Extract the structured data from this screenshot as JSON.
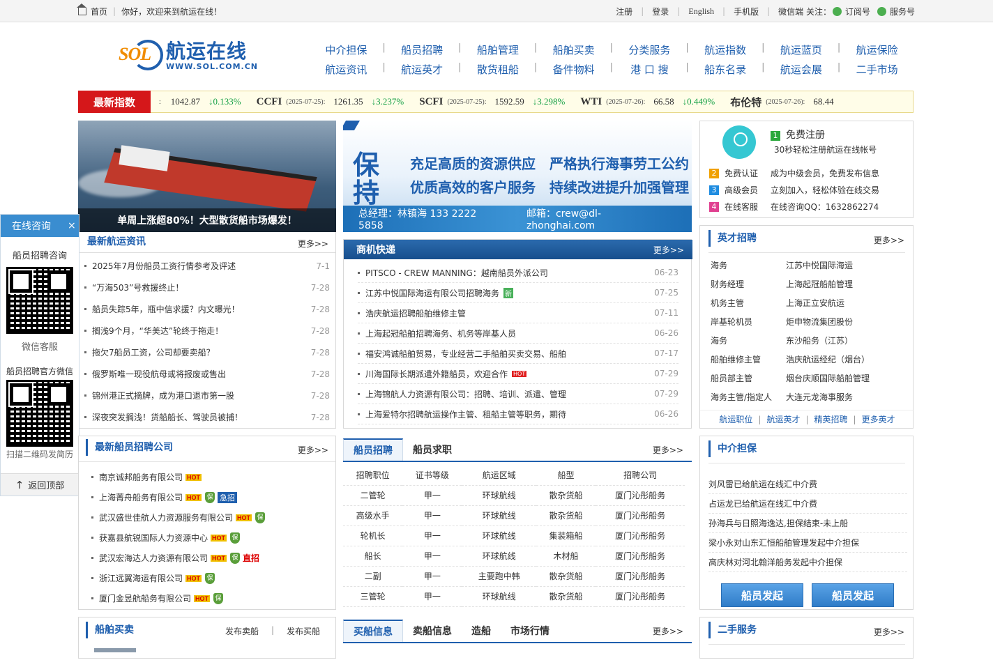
{
  "topbar": {
    "home": "首页",
    "welcome": "你好，欢迎来到航运在线！",
    "register": "注册",
    "login": "登录",
    "english": "English",
    "mobile": "手机版",
    "wechat_follow": "微信端 关注：",
    "subscription": "订阅号",
    "service": "服务号"
  },
  "logo": {
    "mark": "SOL",
    "cn": "航运在线",
    "url": "WWW.SOL.COM.CN"
  },
  "nav": {
    "row1": [
      "中介担保",
      "船员招聘",
      "船舶管理",
      "船舶买卖",
      "分类服务",
      "航运指数",
      "航运蓝页",
      "航运保险"
    ],
    "row2": [
      "航运资讯",
      "航运英才",
      "散货租船",
      "备件物料",
      "港 口 搜",
      "船东名录",
      "航运会展",
      "二手市场"
    ]
  },
  "ticker": {
    "label": "最新指数",
    "lead_colon": ":",
    "lead_value": "1042.87",
    "lead_change": "↓0.133%",
    "items": [
      {
        "name": "CCFI",
        "date": "(2025-07-25):",
        "value": "1261.35",
        "change": "↓3.237%"
      },
      {
        "name": "SCFI",
        "date": "(2025-07-25):",
        "value": "1592.59",
        "change": "↓3.298%"
      },
      {
        "name": "WTI",
        "date": "(2025-07-26):",
        "value": "66.58",
        "change": "↓0.449%"
      },
      {
        "name": "布伦特",
        "date": "(2025-07-26):",
        "value": "68.44",
        "change": ""
      }
    ]
  },
  "photo": {
    "caption": "单周上涨超80%！大型散货船市场爆发！"
  },
  "banner": {
    "big": "保持",
    "line1": "充足高质的资源供应　严格执行海事劳工公约",
    "line2": "优质高效的客户服务　持续改进提升加强管理",
    "manager": "总经理：林镇海 133 2222 5858",
    "email": "邮箱：crew@dl-zhonghai.com"
  },
  "register": {
    "step1": "免费注册",
    "step1_sub": "30秒轻松注册航运在线帐号",
    "rows": [
      {
        "num": "2",
        "key": "免费认证",
        "val": "成为中级会员，免费发布信息"
      },
      {
        "num": "3",
        "key": "高级会员",
        "val": "立刻加入，轻松体验在线交易"
      },
      {
        "num": "4",
        "key": "在线客服",
        "val": "在线咨询QQ：1632862274"
      }
    ]
  },
  "news": {
    "title": "最新航运资讯",
    "more": "更多>>",
    "items": [
      {
        "t": "2025年7月份船员工资行情参考及评述",
        "d": "7-1"
      },
      {
        "t": "“万海503”号救援终止！",
        "d": "7-28"
      },
      {
        "t": "船员失踪5年，瓶中信求援？内文曝光！",
        "d": "7-28"
      },
      {
        "t": "搁浅9个月，“华美达”轮终于拖走！",
        "d": "7-28"
      },
      {
        "t": "拖欠7船员工资，公司却要卖船？",
        "d": "7-28"
      },
      {
        "t": "俄罗斯唯一现役航母或将报废或售出",
        "d": "7-28"
      },
      {
        "t": "锦州港正式摘牌，成为港口退市第一股",
        "d": "7-28"
      },
      {
        "t": "深夜突发搁浅！货船船长、驾驶员被捕！",
        "d": "7-28"
      }
    ]
  },
  "biz": {
    "title": "商机快递",
    "more": "更多>>",
    "items": [
      {
        "t": "PITSCO - CREW MANNING：越南船员外派公司",
        "d": "06-23",
        "tag": ""
      },
      {
        "t": "江苏中悦国际海运有限公司招聘海务",
        "d": "07-25",
        "tag": "new"
      },
      {
        "t": "浩庆航运招聘船舶维修主管",
        "d": "07-11",
        "tag": ""
      },
      {
        "t": "上海起冠船舶招聘海务、机务等岸基人员",
        "d": "06-26",
        "tag": ""
      },
      {
        "t": "福安鸿诚船舶贸易，专业经营二手船舶买卖交易、船舶",
        "d": "07-17",
        "tag": ""
      },
      {
        "t": "川海国际长期派遣外籍船员，欢迎合作",
        "d": "07-29",
        "tag": "hot"
      },
      {
        "t": "上海锦航人力资源有限公司：招聘、培训、派遣、管理",
        "d": "07-29",
        "tag": ""
      },
      {
        "t": "上海爱特尔招聘航运操作主管、租船主管等职务，期待",
        "d": "06-26",
        "tag": ""
      }
    ],
    "new_label": "新",
    "hot_label": "HOT"
  },
  "talent": {
    "title": "英才招聘",
    "more": "更多>>",
    "rows": [
      [
        "海务",
        "江苏中悦国际海运"
      ],
      [
        "财务经理",
        "上海起冠船舶管理"
      ],
      [
        "机务主管",
        "上海正立安航运"
      ],
      [
        "岸基轮机员",
        "炬申物流集团股份"
      ],
      [
        "海务",
        "东沙船务（江苏）"
      ],
      [
        "船舶维修主管",
        "浩庆航运经纪（烟台）"
      ],
      [
        "船员部主管",
        "烟台庆顺国际船舶管理"
      ],
      [
        "海务主管/指定人",
        "大连元龙海事服务"
      ]
    ],
    "foot": [
      "航运职位",
      "航运英才",
      "精英招聘",
      "更多英才"
    ]
  },
  "side": {
    "head": "在线咨询",
    "close": "×",
    "t1": "船员招聘咨询",
    "t2": "微信客服",
    "t3": "船员招聘官方微信",
    "t4": "扫描二维码发简历",
    "top": "返回顶部"
  },
  "companies": {
    "title": "最新船员招聘公司",
    "more": "更多>>",
    "items": [
      {
        "t": "南京诚邦船务有限公司",
        "tags": [
          "hot"
        ]
      },
      {
        "t": "上海菁舟船务有限公司",
        "tags": [
          "hot",
          "bao",
          "ji"
        ]
      },
      {
        "t": "武汉盛世佳航人力资源服务有限公司",
        "tags": [
          "hot",
          "bao"
        ]
      },
      {
        "t": "获嘉县航锐国际人力资源中心",
        "tags": [
          "hot",
          "bao"
        ]
      },
      {
        "t": "武汉宏海达人力资源有限公司",
        "tags": [
          "hot",
          "bao",
          "zhi"
        ]
      },
      {
        "t": "浙江远翼海运有限公司",
        "tags": [
          "hot",
          "bao"
        ]
      },
      {
        "t": "厦门金昱航船务有限公司",
        "tags": [
          "hot",
          "bao"
        ]
      }
    ],
    "hot": "HOT",
    "bao": "保",
    "ji": "急招",
    "zhi": "直招"
  },
  "jobs": {
    "tabs": [
      "船员招聘",
      "船员求职"
    ],
    "more": "更多>>",
    "headers": [
      "招聘职位",
      "证书等级",
      "航运区域",
      "船型",
      "招聘公司"
    ],
    "rows": [
      [
        "二管轮",
        "甲一",
        "环球航线",
        "散杂货船",
        "厦门沁彤船务"
      ],
      [
        "高级水手",
        "甲一",
        "环球航线",
        "散杂货船",
        "厦门沁彤船务"
      ],
      [
        "轮机长",
        "甲一",
        "环球航线",
        "集装箱船",
        "厦门沁彤船务"
      ],
      [
        "船长",
        "甲一",
        "环球航线",
        "木材船",
        "厦门沁彤船务"
      ],
      [
        "二副",
        "甲一",
        "主要跑中韩",
        "散杂货船",
        "厦门沁彤船务"
      ],
      [
        "三管轮",
        "甲一",
        "环球航线",
        "散杂货船",
        "厦门沁彤船务"
      ]
    ]
  },
  "guarantee": {
    "title": "中介担保",
    "items": [
      "刘风雷已给航运在线汇中介费",
      "占运龙已给航运在线汇中介费",
      "孙海兵与日照海逸达,担保结束-未上船",
      "梁小永对山东汇恒船舶管理发起中介担保",
      "高庆林对河北翰洋船务发起中介担保"
    ],
    "btn1": "船员发起",
    "btn2": "船员发起"
  },
  "trade": {
    "title": "船舶买卖",
    "sell": "发布卖船",
    "buy": "发布买船",
    "tabs": [
      "买船信息",
      "卖船信息",
      "造船",
      "市场行情"
    ],
    "more": "更多>>"
  },
  "secondhand": {
    "title": "二手服务",
    "more": "更多>>"
  }
}
